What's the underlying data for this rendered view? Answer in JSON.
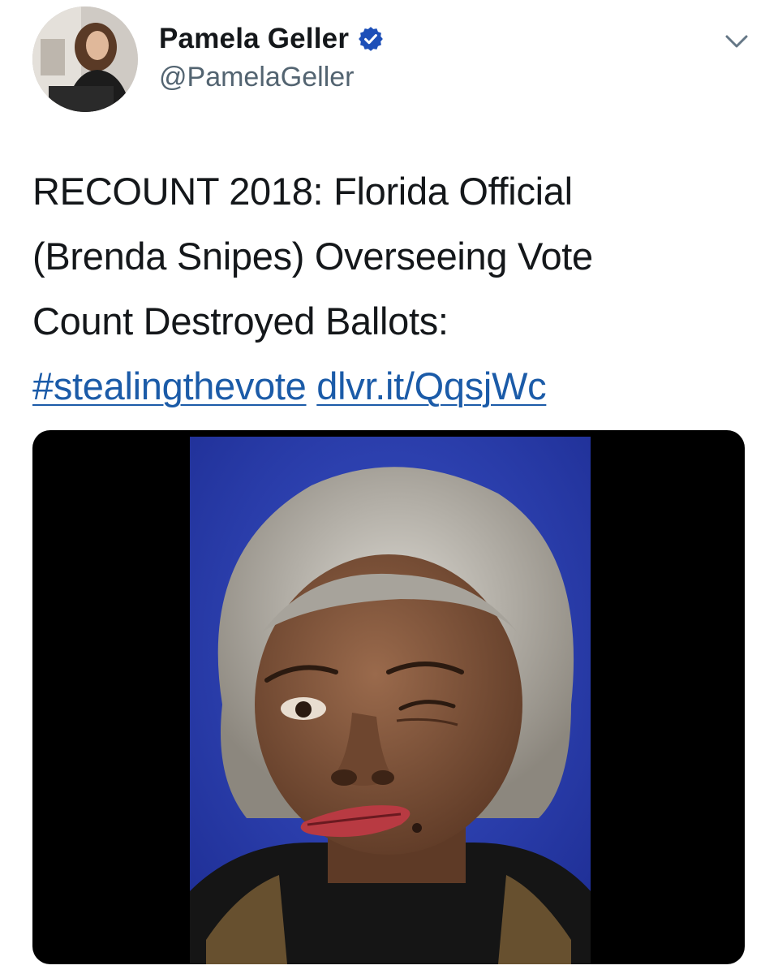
{
  "tweet": {
    "display_name": "Pamela Geller",
    "handle": "@PamelaGeller",
    "verified": true,
    "text_lines": [
      "RECOUNT 2018: Florida Official",
      "(Brenda Snipes) Overseeing Vote",
      "Count Destroyed Ballots:"
    ],
    "hashtag": "#stealingthevote",
    "link": "dlvr.it/QqsjWc"
  },
  "icons": {
    "verified": "verified-badge-icon",
    "more": "chevron-down-icon"
  },
  "colors": {
    "verified": "#1d4fb8",
    "link": "#1b5ba8",
    "text": "#14171a",
    "handle": "#536471",
    "media_background": "#000000",
    "photo_background": "#2a3fb0"
  }
}
